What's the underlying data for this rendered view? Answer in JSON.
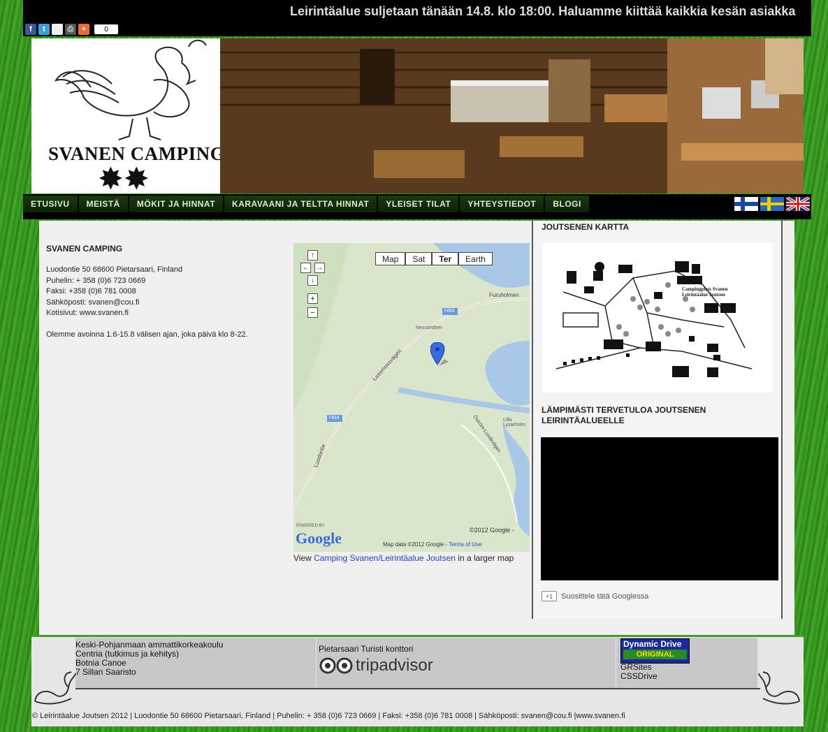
{
  "social": {
    "share_count": "0"
  },
  "ticker": "Leirintäalue suljetaan tänään 14.8. klo 18:00. Haluamme kiittää kaikkia kesän asiakka",
  "header": {
    "logo_text": "SVANEN CAMPING",
    "logo_stars": "✸✸"
  },
  "nav": {
    "items": [
      "ETUSIVU",
      "MEISTÄ",
      "MÖKIT JA HINNAT",
      "KARAVAANI JA TELTTA HINNAT",
      "YLEISET TILAT",
      "YHTEYSTIEDOT",
      "BLOGI"
    ]
  },
  "info": {
    "title": "SVANEN CAMPING",
    "address": "Luodontie 50 68600 Pietarsaari, Finland",
    "phone": "Puhelin: + 358 (0)6 723 0669",
    "fax": "Faksi: +358 (0)6 781 0008",
    "email": "Sähköposti: svanen@cou.fi",
    "website": "Kotisivut: www.svanen.fi",
    "hours": "Olemme avoinna 1.6-15.8 välisen ajan, joka päivä klo 8-22."
  },
  "map": {
    "types": [
      "Map",
      "Sat",
      "Ter",
      "Earth"
    ],
    "selected_type": "Ter",
    "road_label_1": "7494",
    "road_label_2": "7494",
    "place_1": "Furuholmen",
    "place_2": "Nessandren",
    "place_3": "Lassmossvägen",
    "place_4": "Lilla Lysarholm",
    "place_5": "Luodontie",
    "place_6": "Öström-Lundkvägen",
    "copyright": "©2012 Google -",
    "map_data": "Map data ©2012 Google -",
    "terms": "Terms of Use",
    "powered_by": "POWERED BY",
    "google": "Google",
    "view_prefix": "View ",
    "view_link": "Camping Svanen/Leirintäalue Joutsen",
    "view_suffix": " in a larger map"
  },
  "sidebar": {
    "map_heading": "JOUTSENEN KARTTA",
    "site_map_caption": "Campingplats Svanen Leirintäalue Joutsen",
    "welcome_heading": "LÄMPIMÄSTI TERVETULOA JOUTSENEN LEIRINTÄALUEELLE",
    "gplus_icon": "+1",
    "gplus_text": "Suosittele tätä Googlessa"
  },
  "footer": {
    "col1": [
      "Keski-Pohjanmaan ammattikorkeakoulu",
      "Centria (tutkimus ja kehitys)",
      "Botnia Canoe",
      "7 Sillan Saaristo"
    ],
    "col2_title": "Pietarsaari Turisti konttori",
    "tripadvisor": "tripadvisor",
    "dd_line1": "Dynamic Drive",
    "dd_line2": "ORIGINAL",
    "col3": [
      "GRSites",
      "CSSDrive"
    ],
    "copyright": "© Leirintäalue Joutsen 2012 | Luodontie 50 68600 Pietarsaari, Finland | Puhelin: + 358 (0)6 723 0669 | Faksi: +358 (0)6 781 0008 | Sähköposti: svanen@cou.fi |www.svanen.fi"
  },
  "colors": {
    "nav_text": "#d8f0c8",
    "link": "#2244cc",
    "grass": "#3fa323"
  }
}
